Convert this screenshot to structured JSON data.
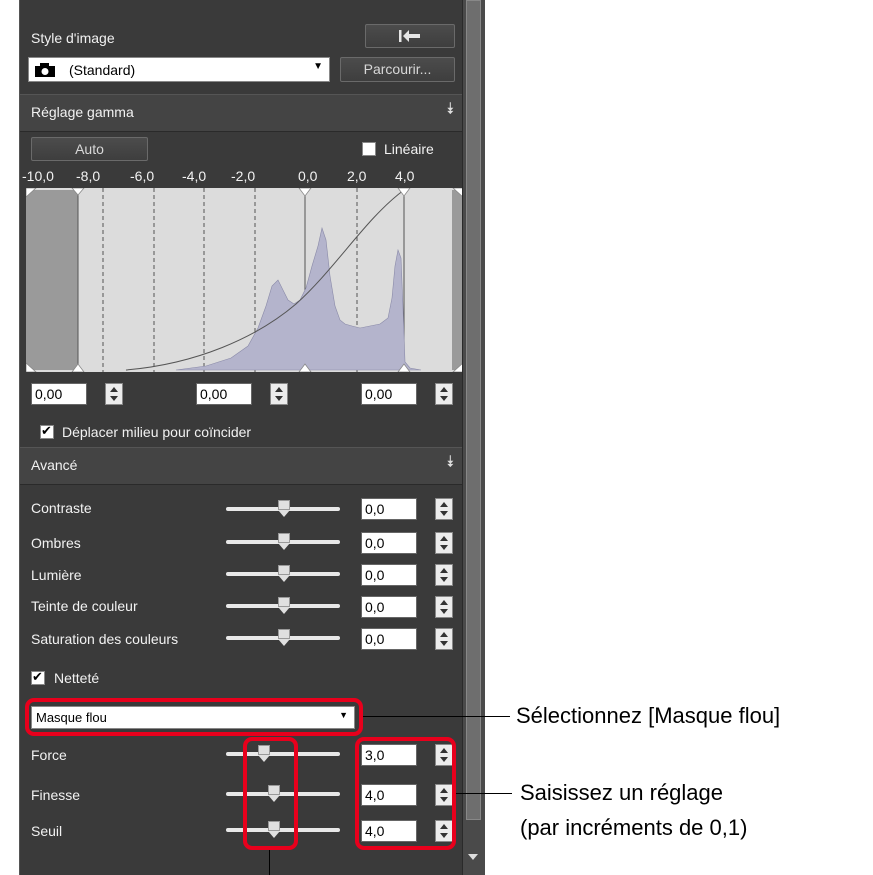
{
  "style_section": {
    "title": "Style d'image",
    "reset_icon": "reset-arrow-icon",
    "camera_icon": "camera-icon",
    "combo_value": "(Standard)",
    "browse_label": "Parcourir..."
  },
  "gamma": {
    "header": "Réglage gamma",
    "auto_label": "Auto",
    "linear_label": "Linéaire",
    "linear_checked": false,
    "axis_ticks": [
      "-10,0",
      "-8,0",
      "-6,0",
      "-4,0",
      "-2,0",
      "0,0",
      "2,0",
      "4,0"
    ],
    "values": [
      "0,00",
      "0,00",
      "0,00"
    ],
    "move_midpoint_label": "Déplacer milieu pour coïncider",
    "move_midpoint_checked": true
  },
  "advanced": {
    "header": "Avancé",
    "rows": [
      {
        "label": "Contraste",
        "value": "0,0"
      },
      {
        "label": "Ombres",
        "value": "0,0"
      },
      {
        "label": "Lumière",
        "value": "0,0"
      },
      {
        "label": "Teinte de couleur",
        "value": "0,0"
      },
      {
        "label": "Saturation des couleurs",
        "value": "0,0"
      }
    ],
    "sharpness_label": "Netteté",
    "sharpness_checked": true,
    "mode_value": "Masque flou",
    "sharp_rows": [
      {
        "label": "Force",
        "value": "3,0"
      },
      {
        "label": "Finesse",
        "value": "4,0"
      },
      {
        "label": "Seuil",
        "value": "4,0"
      }
    ]
  },
  "annotations": {
    "select_mask": "Sélectionnez [Masque flou]",
    "enter_setting_1": "Saisissez un réglage",
    "enter_setting_2": "(par incréments de 0,1)"
  },
  "colors": {
    "highlight": "#e8001c",
    "panel_bg": "#3a3a3a",
    "histogram_fill": "#b4b4cc"
  }
}
